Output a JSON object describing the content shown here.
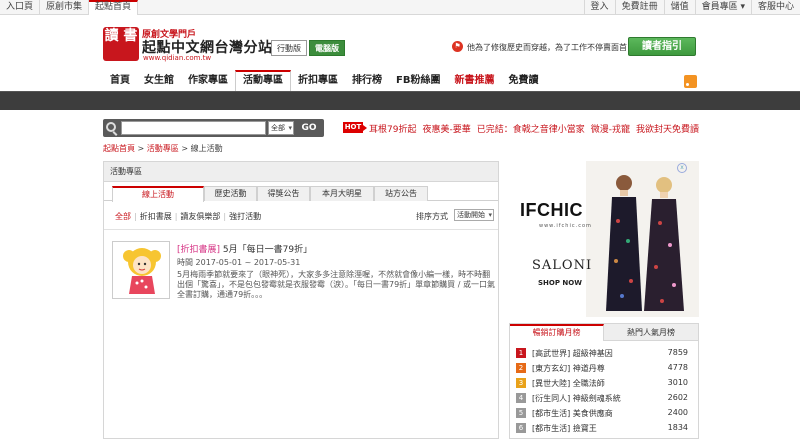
{
  "topnav": {
    "left": [
      "入口頁",
      "原創市集",
      "起點首頁"
    ],
    "right": [
      "登入",
      "免費註冊",
      "儲值",
      "會員專區 ▾",
      "客服中心"
    ]
  },
  "header": {
    "logo_badge": "讀 書",
    "logo_sub": "原創文學門戶",
    "logo_main": "起點中文網台灣分站",
    "logo_url": "www.qidian.com.tw",
    "mobile_version": "行動版",
    "pc_version": "電腦版",
    "promo_icon": "⚑",
    "promo_text": "他為了修復歷史而穿越，為了工作不停賣面首",
    "guide_button": "讀者指引"
  },
  "mainnav": {
    "items": [
      "首頁",
      "女生館",
      "作家專區",
      "活動專區",
      "折扣專區",
      "排行榜",
      "FB粉絲團",
      "新書推薦",
      "免費讀"
    ]
  },
  "search": {
    "placeholder": "",
    "scope": "全部",
    "go": "GO",
    "hot_label": "HOT",
    "hot_links": [
      "耳根79折起",
      "夜惠美-要華",
      "已完結：食戟之音律小當家",
      "微漫-戎寵",
      "我欲封天免費讀"
    ]
  },
  "breadcrumb": {
    "home": "起點首頁",
    "sep1": " > ",
    "section": "活動專區",
    "sep2": " > ",
    "current": "線上活動"
  },
  "panel": {
    "title": "活動專區",
    "tabs": [
      "線上活動",
      "歷史活動",
      "得獎公告",
      "本月大明星",
      "站方公告"
    ],
    "filters": [
      "全部",
      "折扣書展",
      "讀友俱樂部",
      "強打活動"
    ],
    "sort_label": "排序方式",
    "sort_value": "活動開始",
    "event": {
      "tag": "[折扣書展]",
      "title": " 5月「每日一書79折」",
      "time": "時間 2017-05-01 ~ 2017-05-31",
      "desc": "5月梅雨季節就要來了（眼神死），大家多多注意除溼喔，不然就會像小編一樣，時不時翻出個「驚喜」，不是包包發霉就是衣服發霉（淚）。「每日一書79折」單章節購買 / 或一口氣全書訂購，通通79折。。。"
    }
  },
  "ad": {
    "brand": "IFCHIC",
    "url": "www.ifchic.com",
    "saloni": "SALONI",
    "shop": "SHOP NOW",
    "close": "x"
  },
  "ranking": {
    "tabs": [
      "暢銷訂購月榜",
      "熱門人氣月榜"
    ],
    "rows": [
      {
        "rank": "1",
        "text": "[高武世界] 超級神基因",
        "value": "7859",
        "color": "#c8161d"
      },
      {
        "rank": "2",
        "text": "[東方玄幻] 神道丹尊",
        "value": "4778",
        "color": "#e66a17"
      },
      {
        "rank": "3",
        "text": "[異世大陸] 全職法師",
        "value": "3010",
        "color": "#e9a21a"
      },
      {
        "rank": "4",
        "text": "[衍生同人] 神級劍魂系統",
        "value": "2602",
        "color": "#999999"
      },
      {
        "rank": "5",
        "text": "[都市生活] 美食供應商",
        "value": "2400",
        "color": "#999999"
      },
      {
        "rank": "6",
        "text": "[都市生活] 撿寶王",
        "value": "1834",
        "color": "#999999"
      }
    ]
  }
}
